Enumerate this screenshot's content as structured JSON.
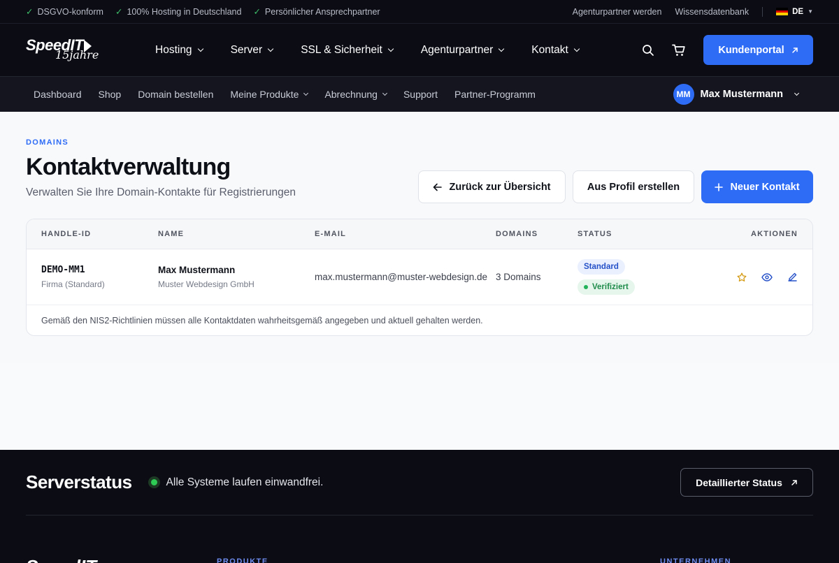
{
  "topbar": {
    "badges": [
      "DSGVO-konform",
      "100% Hosting in Deutschland",
      "Persönlicher Ansprechpartner"
    ],
    "links": [
      "Agenturpartner werden",
      "Wissensdatenbank"
    ],
    "language": "DE"
  },
  "brand": {
    "name": "SpeedIT",
    "tagline": "15jahre"
  },
  "mainnav": {
    "items": [
      "Hosting",
      "Server",
      "SSL & Sicherheit",
      "Agenturpartner",
      "Kontakt"
    ],
    "portal_label": "Kundenportal"
  },
  "subnav": {
    "items": [
      "Dashboard",
      "Shop",
      "Domain bestellen",
      "Meine Produkte",
      "Abrechnung",
      "Support",
      "Partner-Programm"
    ],
    "user": {
      "initials": "MM",
      "name": "Max Mustermann"
    }
  },
  "page": {
    "eyebrow": "DOMAINS",
    "title": "Kontaktverwaltung",
    "subtitle": "Verwalten Sie Ihre Domain-Kontakte für Registrierungen",
    "actions": {
      "back": "Zurück zur Übersicht",
      "from_profile": "Aus Profil erstellen",
      "new_contact": "Neuer Kontakt"
    }
  },
  "table": {
    "headers": [
      "HANDLE-ID",
      "NAME",
      "E-MAIL",
      "DOMAINS",
      "STATUS",
      "AKTIONEN"
    ],
    "rows": [
      {
        "handle": "DEMO-MM1",
        "type": "Firma (Standard)",
        "name": "Max Mustermann",
        "company": "Muster Webdesign GmbH",
        "email": "max.mustermann@muster-webdesign.de",
        "domains": "3 Domains",
        "status_primary": "Standard",
        "status_secondary": "Verifiziert"
      }
    ],
    "note": "Gemäß den NIS2-Richtlinien müssen alle Kontaktdaten wahrheitsgemäß angegeben und aktuell gehalten werden."
  },
  "footer": {
    "status_title": "Serverstatus",
    "status_text": "Alle Systeme laufen einwandfrei.",
    "status_button": "Detaillierter Status",
    "col_headings": [
      "PRODUKTE",
      "UNTERNEHMEN"
    ]
  },
  "colors": {
    "accent": "#2f6cf6",
    "dark": "#0b0c14",
    "success": "#22b35a"
  }
}
